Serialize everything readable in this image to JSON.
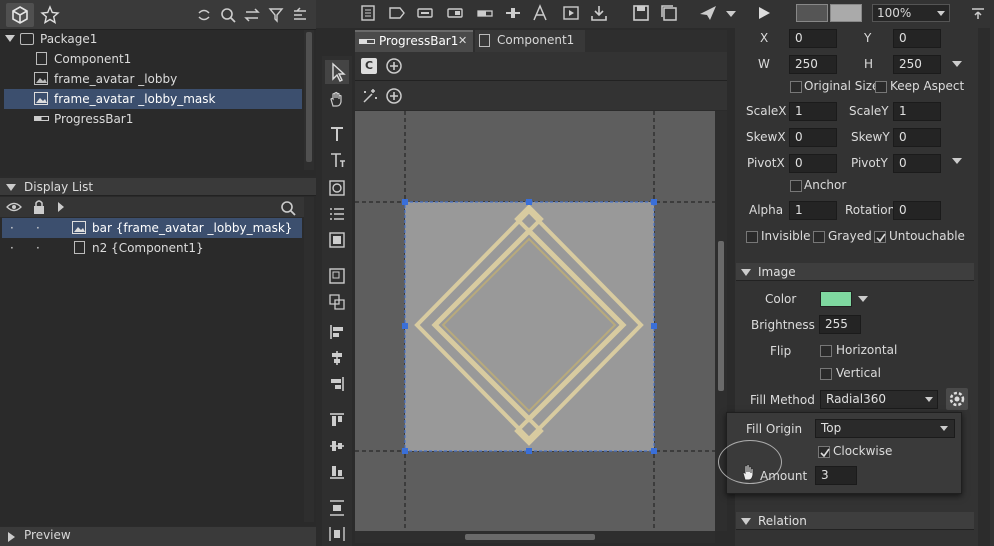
{
  "library": {
    "items": [
      {
        "label": "Package1",
        "type": "package"
      },
      {
        "label": "Component1",
        "type": "component"
      },
      {
        "label": "frame_avatar _lobby",
        "type": "image"
      },
      {
        "label": "frame_avatar _lobby_mask",
        "type": "image"
      },
      {
        "label": "ProgressBar1",
        "type": "progressbar"
      }
    ]
  },
  "display_list": {
    "title": "Display List",
    "rows": [
      {
        "label": "bar {frame_avatar _lobby_mask}"
      },
      {
        "label": "n2 {Component1}"
      }
    ]
  },
  "preview": {
    "title": "Preview"
  },
  "tabs": [
    {
      "label": "ProgressBar1",
      "close": "✕"
    },
    {
      "label": "Component1"
    }
  ],
  "toolbar": {
    "zoom": "100%"
  },
  "stage_tools": {
    "c_label": "C"
  },
  "inspector": {
    "x_label": "X",
    "x": "0",
    "y_label": "Y",
    "y": "0",
    "w_label": "W",
    "w": "250",
    "h_label": "H",
    "h": "250",
    "original_size": "Original Size",
    "keep_aspect": "Keep Aspect",
    "scalex_label": "ScaleX",
    "scalex": "1",
    "scaley_label": "ScaleY",
    "scaley": "1",
    "skewx_label": "SkewX",
    "skewx": "0",
    "skewy_label": "SkewY",
    "skewy": "0",
    "pivotx_label": "PivotX",
    "pivotx": "0",
    "pivoty_label": "PivotY",
    "pivoty": "0",
    "anchor": "Anchor",
    "alpha_label": "Alpha",
    "alpha": "1",
    "rotation_label": "Rotation",
    "rotation": "0",
    "invisible": "Invisible",
    "grayed": "Grayed",
    "untouchable": "Untouchable",
    "untouchable_checked": true
  },
  "image_section": {
    "title": "Image",
    "color_label": "Color",
    "color_value": "#7fd8a0",
    "brightness_label": "Brightness",
    "brightness": "255",
    "flip_label": "Flip",
    "horizontal": "Horizontal",
    "vertical": "Vertical",
    "fill_method_label": "Fill Method",
    "fill_method": "Radial360",
    "fill_origin_label": "Fill Origin",
    "fill_origin": "Top",
    "clockwise": "Clockwise",
    "amount_label": "Amount",
    "amount": "3"
  },
  "relation_section": {
    "title": "Relation"
  },
  "colors": {
    "accent": "#3c4f6e",
    "selection_handle": "#3a6fd8",
    "frame_gold": "#d8cba0"
  }
}
